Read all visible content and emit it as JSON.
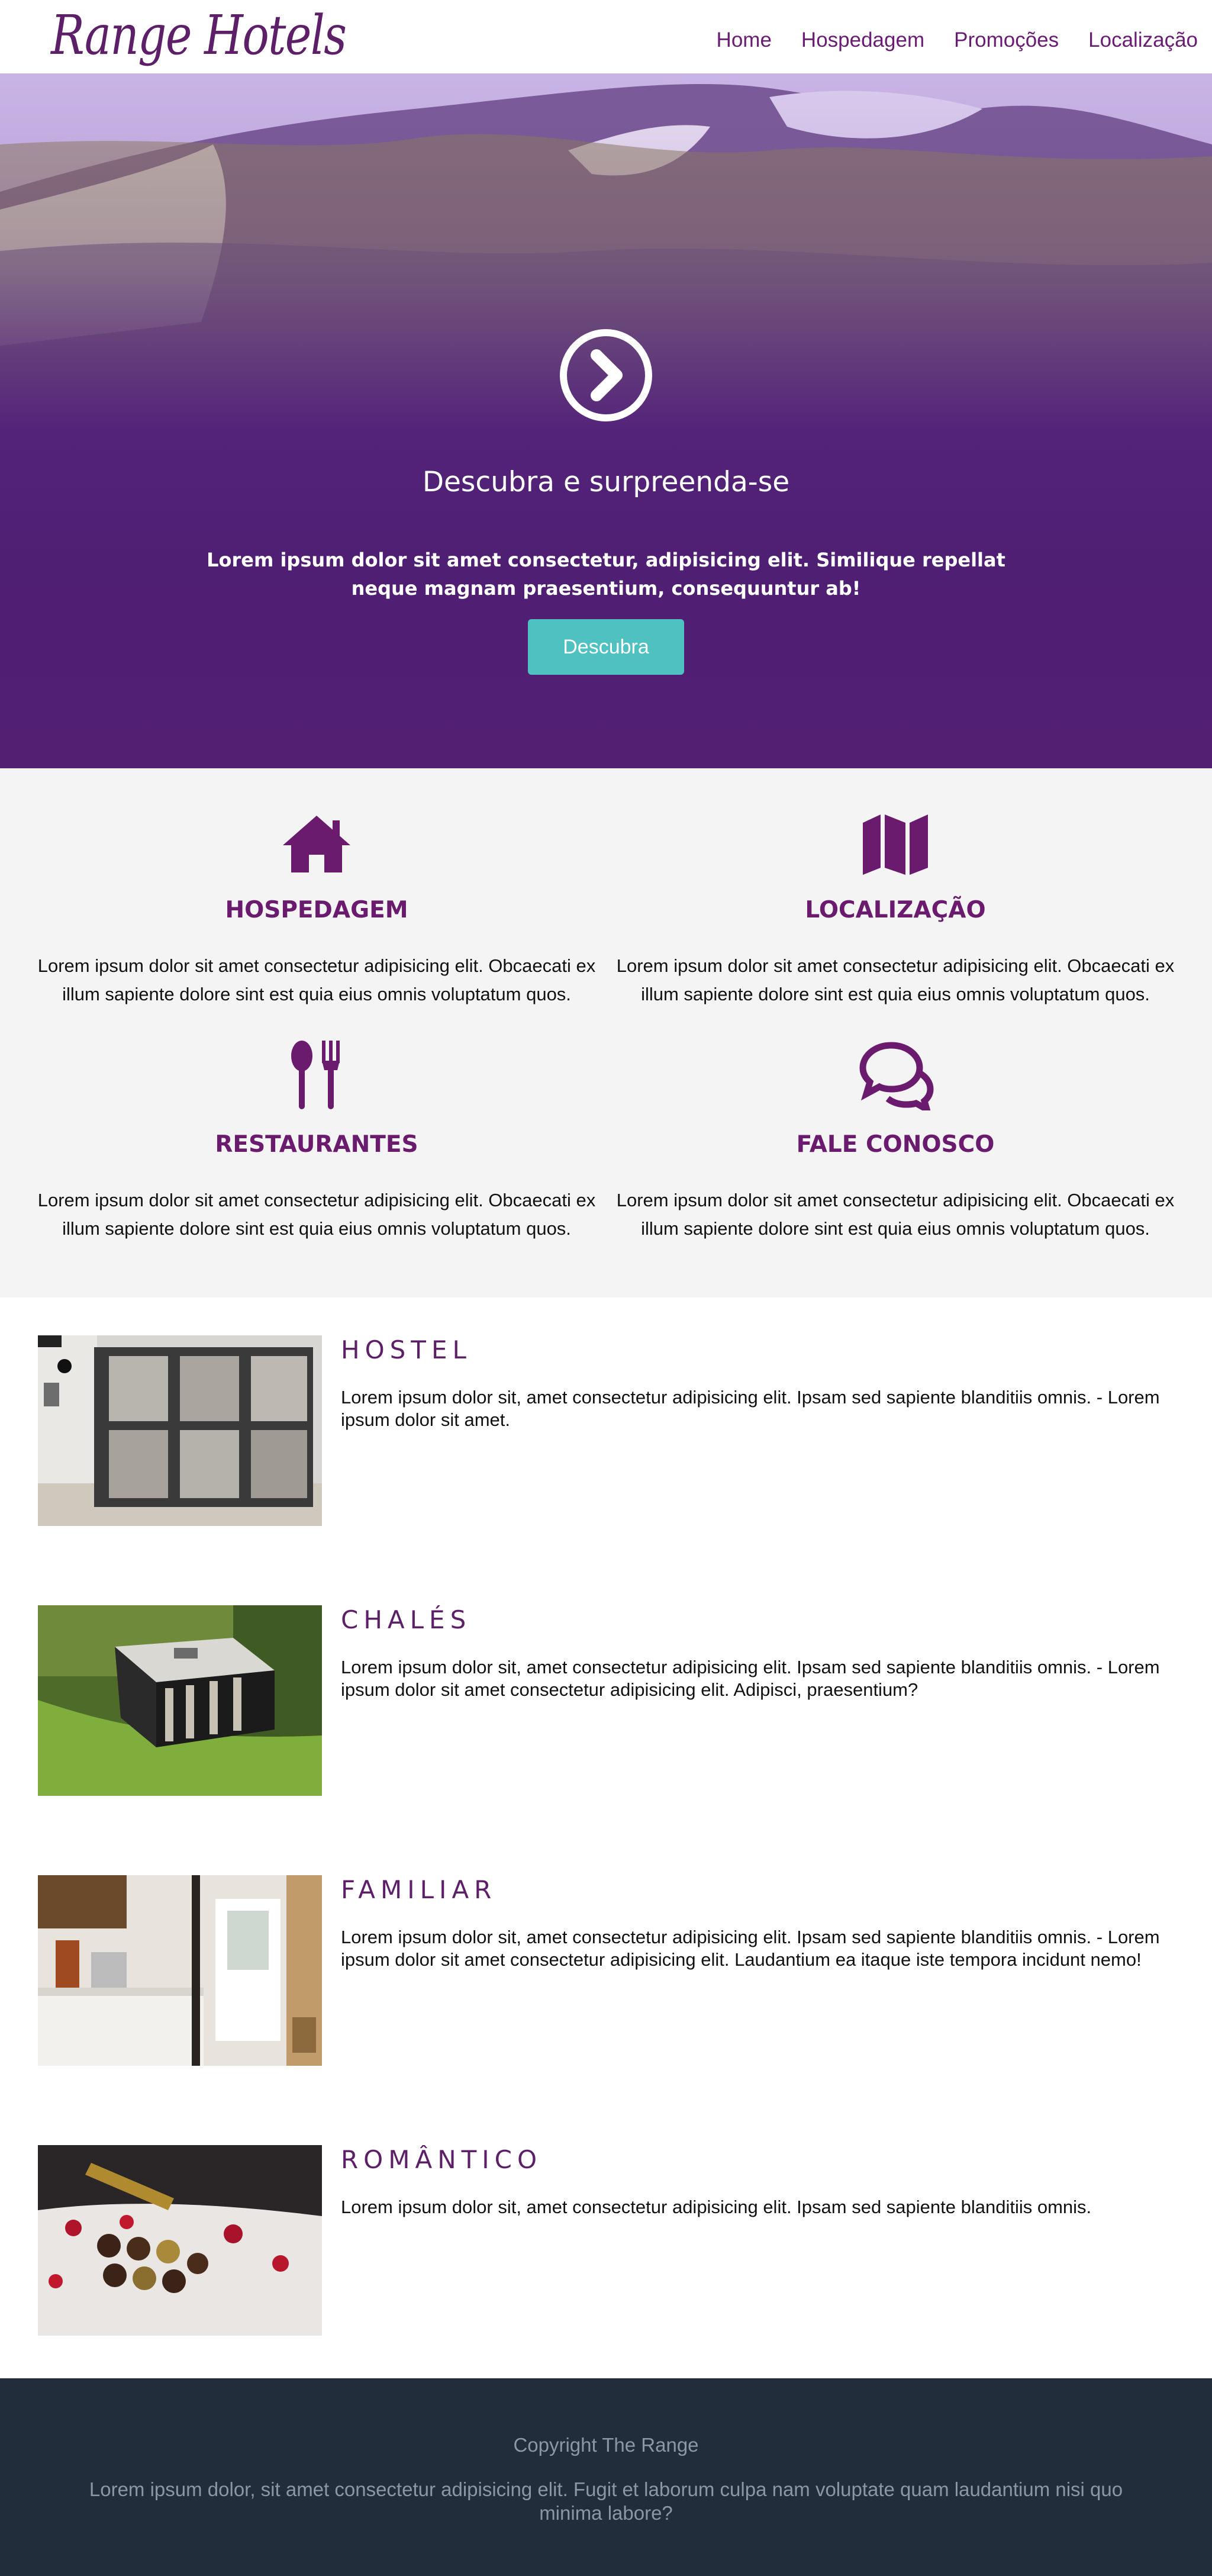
{
  "nav": {
    "brand": "Range Hotels",
    "links": [
      "Home",
      "Hospedagem",
      "Promoções",
      "Localização"
    ]
  },
  "hero": {
    "icon": "chevron-circle-right-icon",
    "title": "Descubra e surpreenda-se",
    "text": "Lorem ipsum dolor sit amet consectetur, adipisicing elit. Similique repellat neque magnam praesentium, consequuntur ab!",
    "button": "Descubra",
    "button_color": "#4fc1c0",
    "overlay_color": "#521f73"
  },
  "features": [
    {
      "icon": "house-icon",
      "title": "HOSPEDAGEM",
      "text": "Lorem ipsum dolor sit amet consectetur adipisicing elit. Obcaecati ex illum sapiente dolore sint est quia eius omnis voluptatum quos."
    },
    {
      "icon": "map-icon",
      "title": "LOCALIZAÇÃO",
      "text": "Lorem ipsum dolor sit amet consectetur adipisicing elit. Obcaecati ex illum sapiente dolore sint est quia eius omnis voluptatum quos."
    },
    {
      "icon": "utensils-icon",
      "title": "RESTAURANTES",
      "text": "Lorem ipsum dolor sit amet consectetur adipisicing elit. Obcaecati ex illum sapiente dolore sint est quia eius omnis voluptatum quos."
    },
    {
      "icon": "chat-bubbles-icon",
      "title": "FALE CONOSCO",
      "text": "Lorem ipsum dolor sit amet consectetur adipisicing elit. Obcaecati ex illum sapiente dolore sint est quia eius omnis voluptatum quos."
    }
  ],
  "rooms": [
    {
      "title": "HOSTEL",
      "text": "Lorem ipsum dolor sit, amet consectetur adipisicing elit. Ipsam sed sapiente blanditiis omnis. - Lorem ipsum dolor sit amet."
    },
    {
      "title": "CHALÉS",
      "text": "Lorem ipsum dolor sit, amet consectetur adipisicing elit. Ipsam sed sapiente blanditiis omnis. - Lorem ipsum dolor sit amet consectetur adipisicing elit. Adipisci, praesentium?"
    },
    {
      "title": "FAMILIAR",
      "text": "Lorem ipsum dolor sit, amet consectetur adipisicing elit. Ipsam sed sapiente blanditiis omnis. - Lorem ipsum dolor sit amet consectetur adipisicing elit. Laudantium ea itaque iste tempora incidunt nemo!"
    },
    {
      "title": "ROMÂNTICO",
      "text": "Lorem ipsum dolor sit, amet consectetur adipisicing elit. Ipsam sed sapiente blanditiis omnis."
    }
  ],
  "footer": {
    "copyright": "Copyright The Range",
    "text": "Lorem ipsum dolor, sit amet consectetur adipisicing elit. Fugit et laborum culpa nam voluptate quam laudantium nisi quo minima labore?"
  },
  "colors": {
    "brand": "#5c1f68",
    "accent": "#4fc1c0",
    "footer_bg": "#222d3c",
    "features_bg": "#f5f4f5"
  }
}
